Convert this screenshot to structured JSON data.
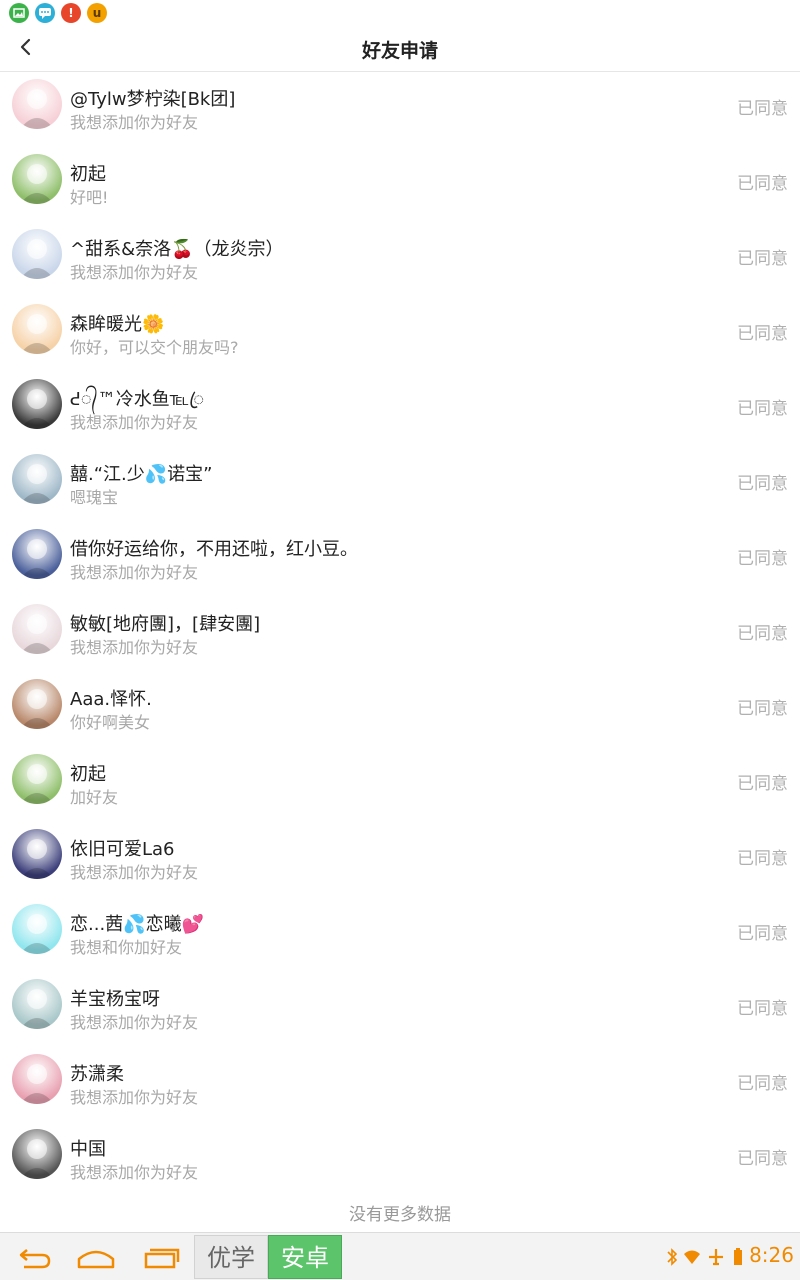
{
  "statusbar": {
    "notification_icons": [
      "image-icon",
      "chat-icon",
      "alert-icon",
      "u-app-icon"
    ],
    "u_letter": "u",
    "alert_mark": "!"
  },
  "header": {
    "title": "好友申请",
    "back_icon": "back-chevron-icon"
  },
  "requests": [
    {
      "name": "@Tylw梦柠染[Bk团]",
      "message": "我想添加你为好友",
      "status": "已同意",
      "avatar_color": "#f6d0d6"
    },
    {
      "name": "初起",
      "message": "好吧!",
      "status": "已同意",
      "avatar_color": "#8fbf6a"
    },
    {
      "name": "^甜系&奈洛🍒（龙炎宗）",
      "message": "我想添加你为好友",
      "status": "已同意",
      "avatar_color": "#c9d6ea"
    },
    {
      "name": "森眸暖光🌼",
      "message": "你好，可以交个朋友吗?",
      "status": "已同意",
      "avatar_color": "#f6d2a8"
    },
    {
      "name": "ᕍ᭄™冷水鱼℡ꦿ",
      "message": "我想添加你为好友",
      "status": "已同意",
      "avatar_color": "#3a3a3a"
    },
    {
      "name": "囍.“江.少💦诺宝”",
      "message": "嗯瑰宝",
      "status": "已同意",
      "avatar_color": "#9fb8c8"
    },
    {
      "name": "借你好运给你，不用还啦，红小豆。",
      "message": "我想添加你为好友",
      "status": "已同意",
      "avatar_color": "#4a5f9a"
    },
    {
      "name": "敏敏[地府團]，[肆安團]",
      "message": "我想添加你为好友",
      "status": "已同意",
      "avatar_color": "#e8d8dc"
    },
    {
      "name": "Aaa.怿怀.",
      "message": "你好啊美女",
      "status": "已同意",
      "avatar_color": "#b8886a"
    },
    {
      "name": "初起",
      "message": "加好友",
      "status": "已同意",
      "avatar_color": "#8fbf6a"
    },
    {
      "name": "依旧可爱La6",
      "message": "我想添加你为好友",
      "status": "已同意",
      "avatar_color": "#3c3f7a"
    },
    {
      "name": "恋...茜💦恋曦💕",
      "message": "我想和你加好友",
      "status": "已同意",
      "avatar_color": "#8fe6ee"
    },
    {
      "name": "羊宝杨宝呀",
      "message": "我想添加你为好友",
      "status": "已同意",
      "avatar_color": "#a9c7c9"
    },
    {
      "name": "苏潇柔",
      "message": "我想添加你为好友",
      "status": "已同意",
      "avatar_color": "#e8a0b0"
    },
    {
      "name": "中国",
      "message": "我想添加你为好友",
      "status": "已同意",
      "avatar_color": "#555555"
    }
  ],
  "footer": {
    "no_more": "没有更多数据"
  },
  "navbar": {
    "brand_left": "优学",
    "brand_right": "安卓",
    "time": "8:26",
    "icons": [
      "back-arrow-icon",
      "home-icon",
      "recent-apps-icon",
      "bluetooth-icon",
      "wifi-icon",
      "airplane-icon",
      "battery-icon"
    ]
  },
  "colors": {
    "accent_orange": "#f08a00",
    "brand_green": "#5cc46b",
    "status_gray": "#b0b0b0"
  }
}
